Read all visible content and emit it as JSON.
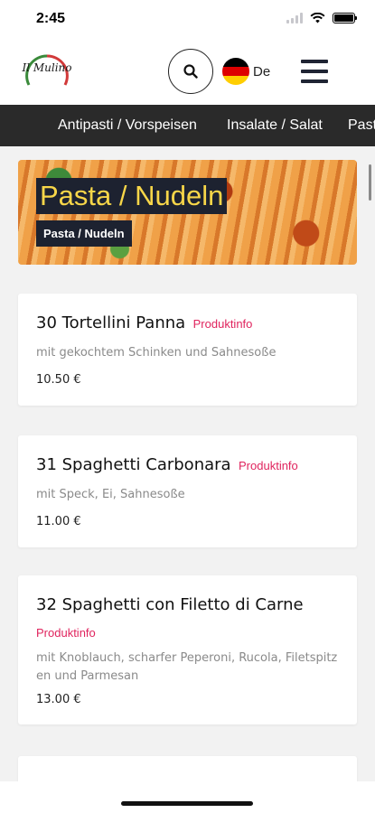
{
  "status": {
    "time": "2:45"
  },
  "header": {
    "logo_text": "Il Mulino",
    "language_label": "De",
    "flag_colors": [
      "#000000",
      "#dd0000",
      "#ffce00"
    ]
  },
  "categories": [
    {
      "label": "Antipasti / Vorspeisen"
    },
    {
      "label": "Insalate / Salat"
    },
    {
      "label": "Pasta / Nudeln"
    }
  ],
  "hero": {
    "title": "Pasta / Nudeln",
    "subtitle": "Pasta / Nudeln"
  },
  "dishes": [
    {
      "name": "30 Tortellini Panna",
      "info_label": "Produktinfo",
      "description": "mit gekochtem Schinken und Sahnesoße",
      "price": "10.50 €"
    },
    {
      "name": "31 Spaghetti Carbonara",
      "info_label": "Produktinfo",
      "description": "mit Speck, Ei, Sahnesoße",
      "price": "11.00 €"
    },
    {
      "name": "32 Spaghetti con Filetto di Carne",
      "info_label": "Produktinfo",
      "description": "mit Knoblauch, scharfer Peperoni, Rucola, Filetspitzen und Parmesan",
      "price": "13.00 €"
    }
  ],
  "colors": {
    "accent": "#e0245e",
    "category_bar": "#2a2a2a",
    "hero_title_text": "#f7d649",
    "hero_label_bg": "#1d2230"
  },
  "icons": [
    "search-icon",
    "hamburger-menu-icon",
    "germany-flag-icon",
    "wifi-icon",
    "battery-icon",
    "signal-icon"
  ]
}
